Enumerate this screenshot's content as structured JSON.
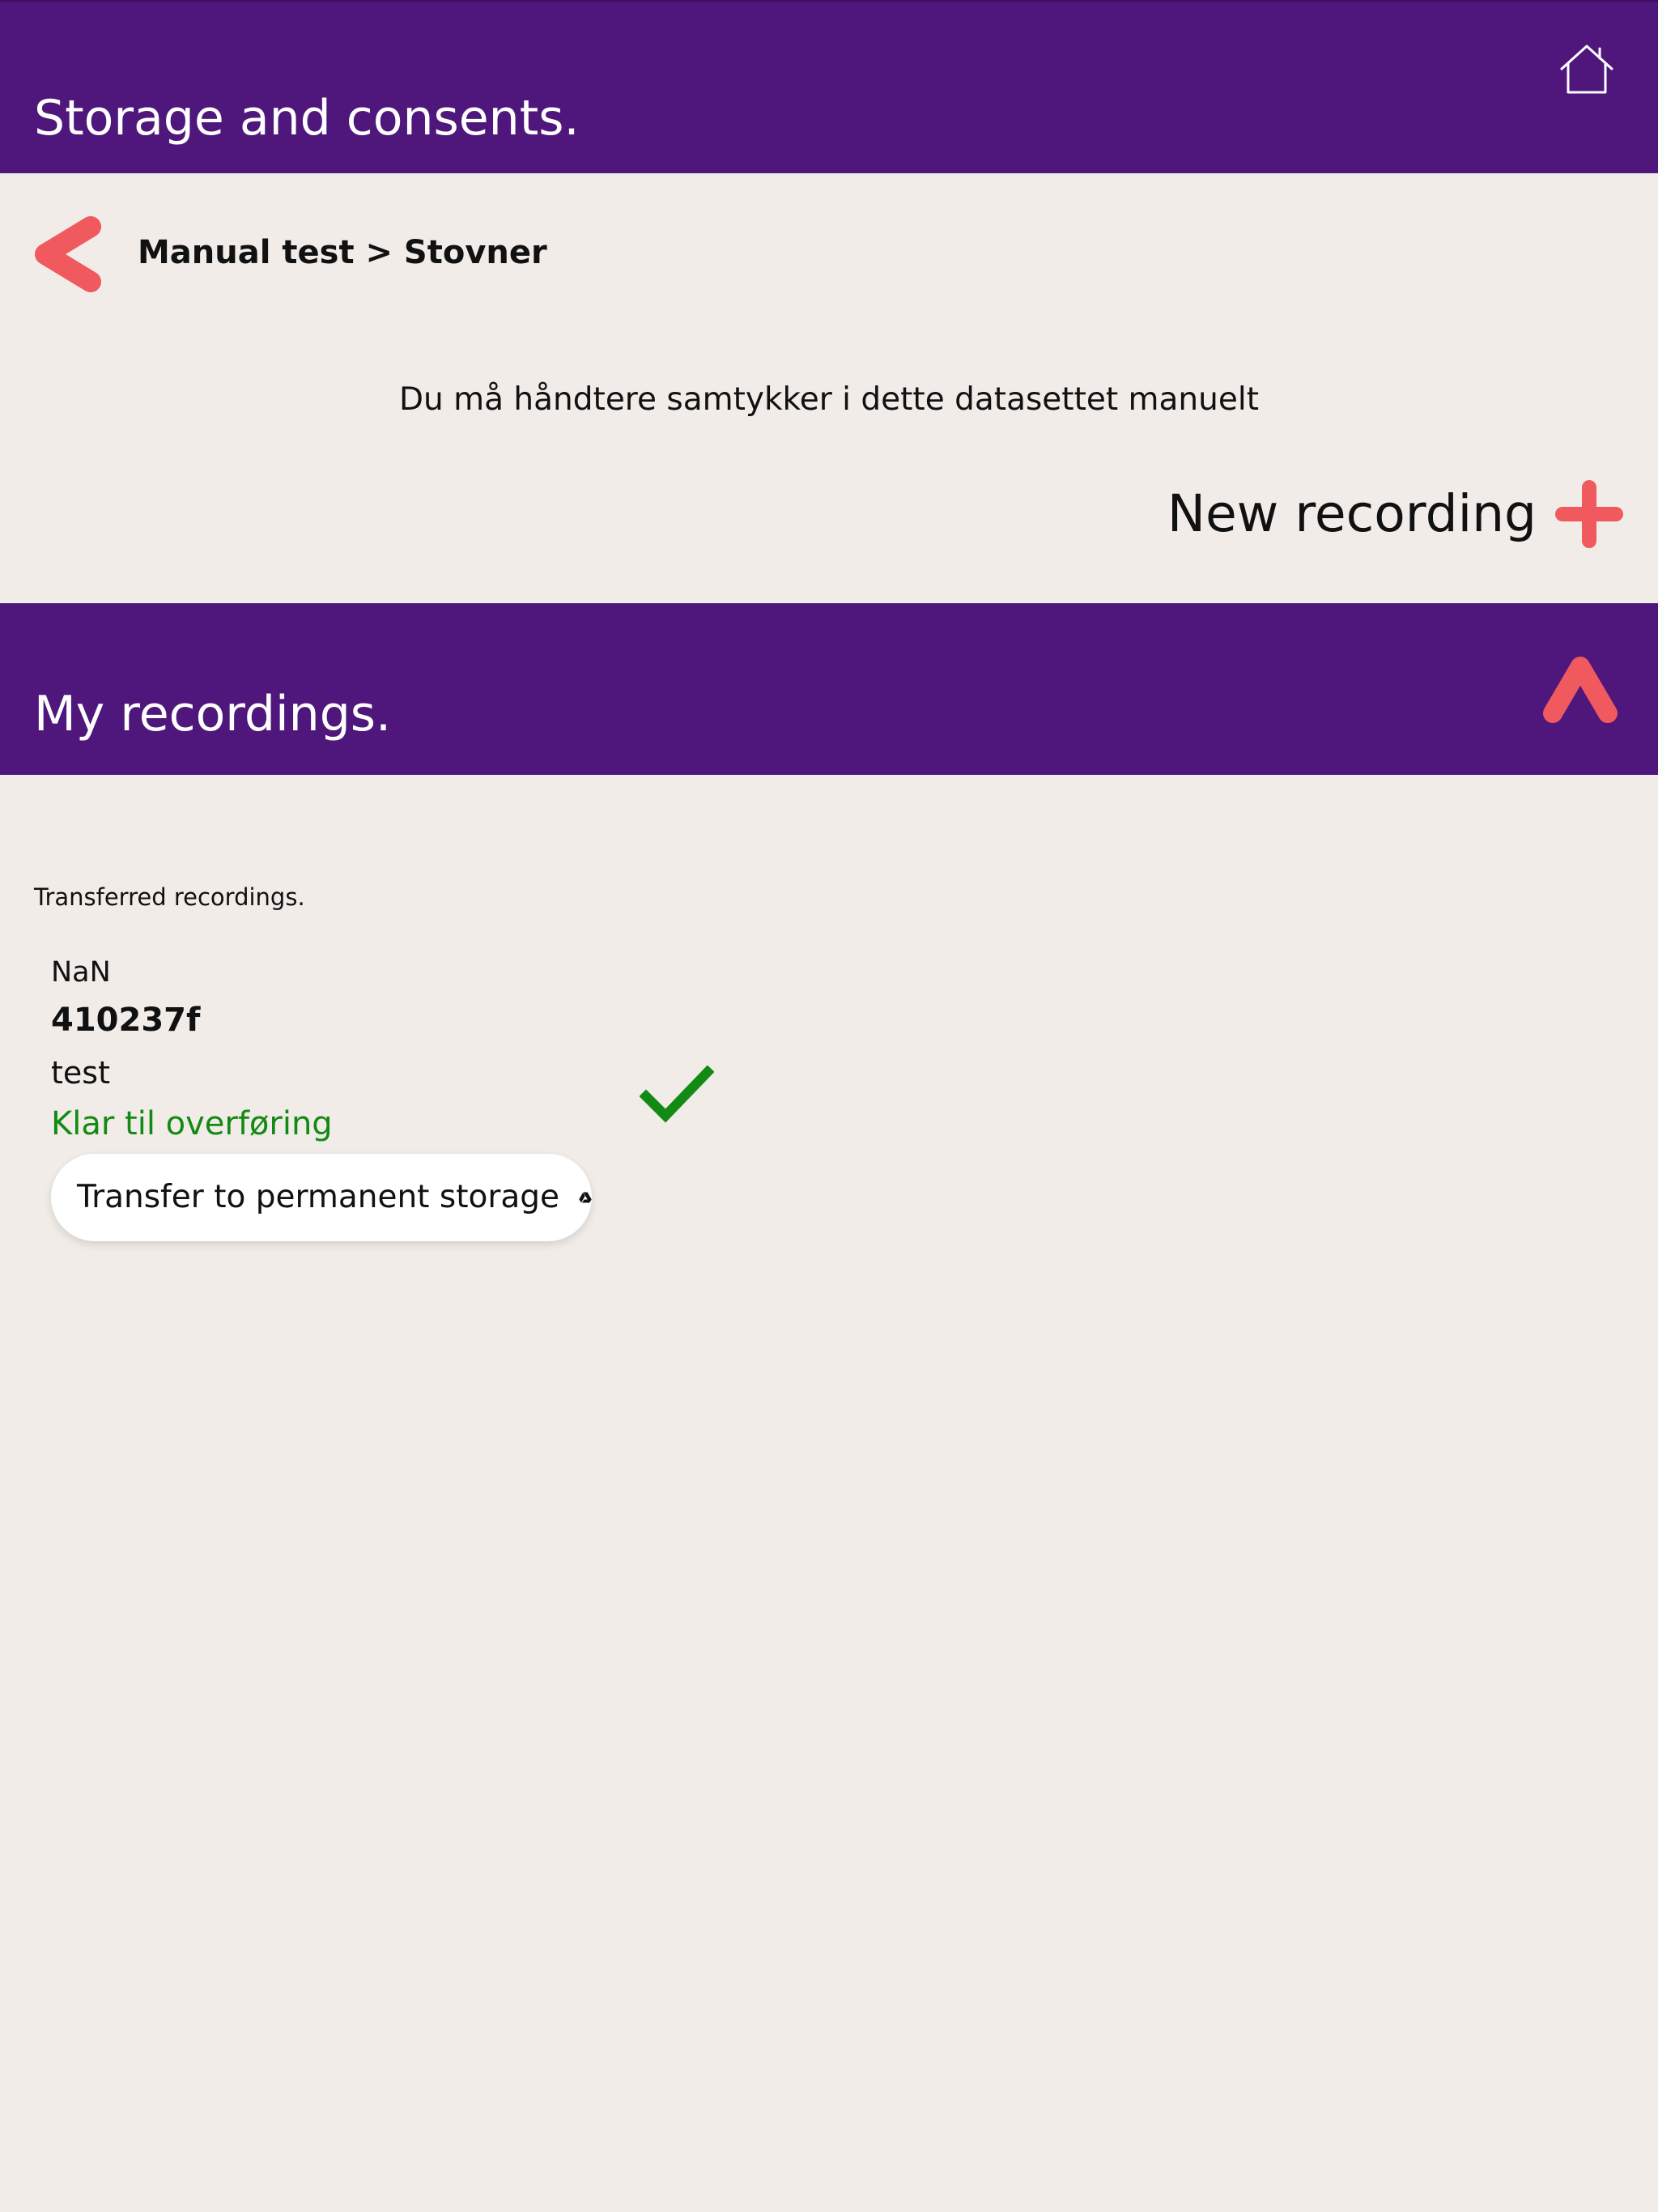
{
  "header": {
    "title": "Storage and consents.",
    "home_icon": "home-icon",
    "background_color": "#4f167c"
  },
  "navigation": {
    "back_icon": "chevron-left-icon",
    "breadcrumb": "Manual test > Stovner"
  },
  "notice": "Du må håndtere samtykker i dette datasettet manuelt",
  "new_recording": {
    "label": "New recording",
    "icon": "plus-icon"
  },
  "recordings_section": {
    "title": "My recordings.",
    "collapse_icon": "chevron-up-icon",
    "transferred_label": "Transferred recordings.",
    "items": [
      {
        "date": "NaN",
        "id": "410237f",
        "name": "test",
        "status": "Klar til overføring",
        "status_icon": "checkmark-icon",
        "transfer_button_label": "Transfer to permanent storage",
        "transfer_icon": "google-drive-icon"
      }
    ]
  },
  "colors": {
    "accent": "#f05a5e",
    "brand_purple": "#4f167c",
    "background": "#f1ece8",
    "success": "#138a13"
  }
}
